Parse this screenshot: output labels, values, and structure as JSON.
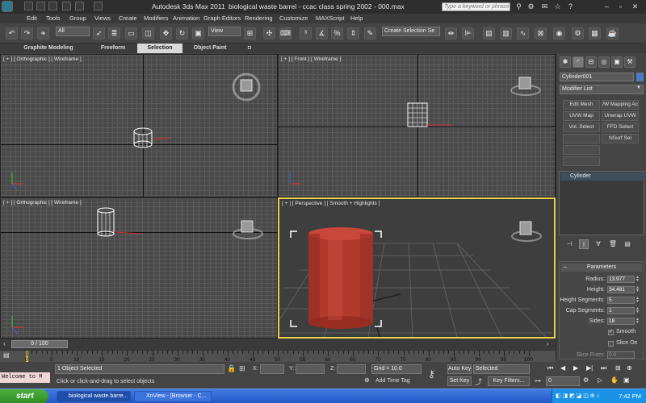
{
  "title_bar": {
    "app_name": "Autodesk 3ds Max  2011",
    "file_title": "biological waste barrel - ccac class spring 2002 - 000.max",
    "search_placeholder": "Type a keyword or phrase"
  },
  "menu": [
    "Edit",
    "Tools",
    "Group",
    "Views",
    "Create",
    "Modifiers",
    "Animation",
    "Graph Editors",
    "Rendering",
    "Customize",
    "MAXScript",
    "Help"
  ],
  "toolbar": {
    "selection_filter": "All",
    "reference_coord": "View",
    "named_selection": "Create Selection Se"
  },
  "ribbon": {
    "tabs": [
      "Graphite Modeling Tools",
      "Freeform",
      "Selection",
      "Object Paint"
    ],
    "active_tab": "Selection"
  },
  "viewports": [
    {
      "label": "[ + ] [ Orthographic ] [ Wireframe ]"
    },
    {
      "label": "[ + ] [ Front ] [ Wireframe ]"
    },
    {
      "label": "[ + ] [ Orthographic ] [ Wireframe ]"
    },
    {
      "label": "[ + ] [ Perspective ] [ Smooth + Highlights ]"
    }
  ],
  "command_panel": {
    "object_name": "Cylinder001",
    "object_color": "#3f7ed8",
    "modifier_list": "Modifier List",
    "modifier_buttons": [
      "Edit Mesh",
      "/W Mapping Ac",
      "UVW Map",
      "Unwrap UVW",
      "Vol. Select",
      "FFD Select",
      "",
      "NSurf Sel",
      "",
      ""
    ],
    "stack_item": "Cylinder",
    "parameters": {
      "title": "Parameters",
      "rows": [
        {
          "label": "Radius:",
          "value": "13.977"
        },
        {
          "label": "Height:",
          "value": "34.481"
        },
        {
          "label": "Height Segments:",
          "value": "5"
        },
        {
          "label": "Cap Segments:",
          "value": "1"
        },
        {
          "label": "Sides:",
          "value": "18"
        }
      ],
      "smooth_label": "Smooth",
      "smooth_checked": true,
      "slice_on_label": "Slice On",
      "slice_on_checked": false,
      "slice_from_label": "Slice From:",
      "slice_from_value": "0.0"
    }
  },
  "timeline": {
    "position": "0 / 100",
    "ticks": [
      "0",
      "5",
      "10",
      "15",
      "20",
      "25",
      "30",
      "35",
      "40",
      "45",
      "50",
      "55",
      "60",
      "65",
      "70",
      "75",
      "80",
      "85",
      "90",
      "95",
      "100"
    ]
  },
  "status_bar": {
    "maxscript_listener": "Welcome to M",
    "selection_info": "1 Object Selected",
    "prompt": "Click or click-and-drag to select objects",
    "x_label": "X:",
    "y_label": "Y:",
    "z_label": "Z:",
    "grid": "Grid = 10.0",
    "add_time_tag": "Add Time Tag",
    "auto_key": "Auto Key",
    "auto_key_mode": "Selected",
    "set_key": "Set Key",
    "key_filters": "Key Filters...",
    "frame": "0"
  },
  "taskbar": {
    "start": "start",
    "tasks": [
      "biological waste barre...",
      "XnView - [Browser - C..."
    ],
    "clock": "7:42 PM"
  }
}
